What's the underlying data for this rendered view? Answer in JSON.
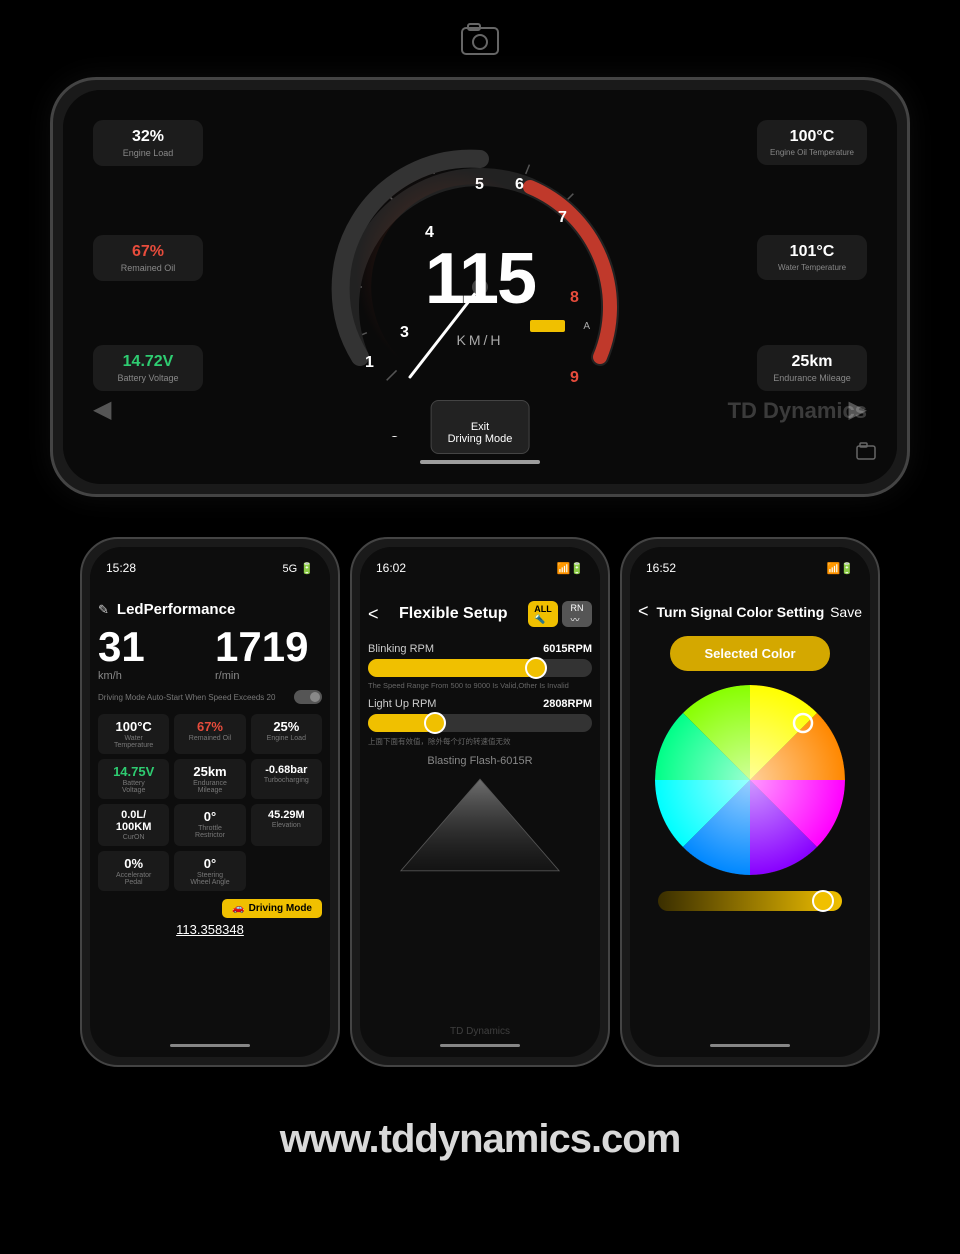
{
  "app": {
    "website": "www.tddynamics.com",
    "brand": "TD Dynamics"
  },
  "top_icon": "screenshot-icon",
  "landscape_phone": {
    "speed": "115",
    "unit": "KM/H",
    "exit_button": "Exit\nDriving Mode",
    "widgets": [
      {
        "id": "engine-load",
        "val": "32%",
        "label": "Engine Load",
        "color": "white",
        "pos": "top-left"
      },
      {
        "id": "remained-oil",
        "val": "67%",
        "label": "Remained Oil",
        "color": "red",
        "pos": "mid-left"
      },
      {
        "id": "battery-voltage",
        "val": "14.72V",
        "label": "Battery Voltage",
        "color": "green",
        "pos": "bot-left"
      },
      {
        "id": "engine-oil-temp",
        "val": "100°C",
        "label": "Engine Oil\nTemperature",
        "color": "white",
        "pos": "top-right"
      },
      {
        "id": "water-temp",
        "val": "101°C",
        "label": "Water\nTemperature",
        "color": "white",
        "pos": "mid-right"
      },
      {
        "id": "endurance-mileage",
        "val": "25km",
        "label": "Endurance\nMileage",
        "color": "white",
        "pos": "bot-right"
      }
    ],
    "watermark": "TD Dynamics"
  },
  "phone1": {
    "time": "15:28",
    "signal": "5G",
    "title": "LedPerformance",
    "speed": "31",
    "rpm": "1719",
    "speed_unit": "km/h",
    "rpm_unit": "r/min",
    "toggle_label": "Driving Mode Auto-Start When Speed Exceeds 20",
    "metrics": [
      {
        "val": "100°C",
        "label": "Water\nTemperature",
        "color": "white"
      },
      {
        "val": "67%",
        "label": "Remained Oil",
        "color": "red"
      },
      {
        "val": "25%",
        "label": "Engine Load",
        "color": "white"
      },
      {
        "val": "14.75V",
        "label": "Battery\nVoltage",
        "color": "green"
      },
      {
        "val": "25km",
        "label": "Endurance\nMileage",
        "color": "white"
      },
      {
        "val": "-0.68bar",
        "label": "Turbocharging",
        "color": "white"
      },
      {
        "val": "0.0L/\n100KM",
        "label": "CurON",
        "color": "white"
      },
      {
        "val": "0°",
        "label": "Throttle\nRestrictor",
        "color": "white"
      },
      {
        "val": "45.29M",
        "label": "Elevation",
        "color": "white"
      },
      {
        "val": "0%",
        "label": "Accelerator\nPedal",
        "color": "white"
      },
      {
        "val": "0°",
        "label": "Steering\nWheel Angle",
        "color": "white"
      }
    ],
    "driving_mode_btn": "Driving Mode",
    "bottom_speed": "113.358348"
  },
  "phone2": {
    "time": "16:02",
    "title": "Flexible Setup",
    "back": "<",
    "blinking_rpm_label": "Blinking RPM",
    "blinking_rpm_val": "6015RPM",
    "blinking_slider_pct": 75,
    "blinking_note": "The Speed Range From 500 to 9000 Is Valid,Other Is Invalid",
    "light_up_label": "Light Up RPM",
    "light_up_val": "2808RPM",
    "light_up_pct": 30,
    "light_up_note": "上面下面有效值，除外每个灯的转速值无效",
    "blasting_label": "Blasting Flash-6015R",
    "watermark": "TD Dynamics"
  },
  "phone3": {
    "time": "16:52",
    "title": "Turn Signal Color Setting",
    "back": "<",
    "save": "Save",
    "selected_color_btn": "Selected Color",
    "brightness_pct": 85
  }
}
